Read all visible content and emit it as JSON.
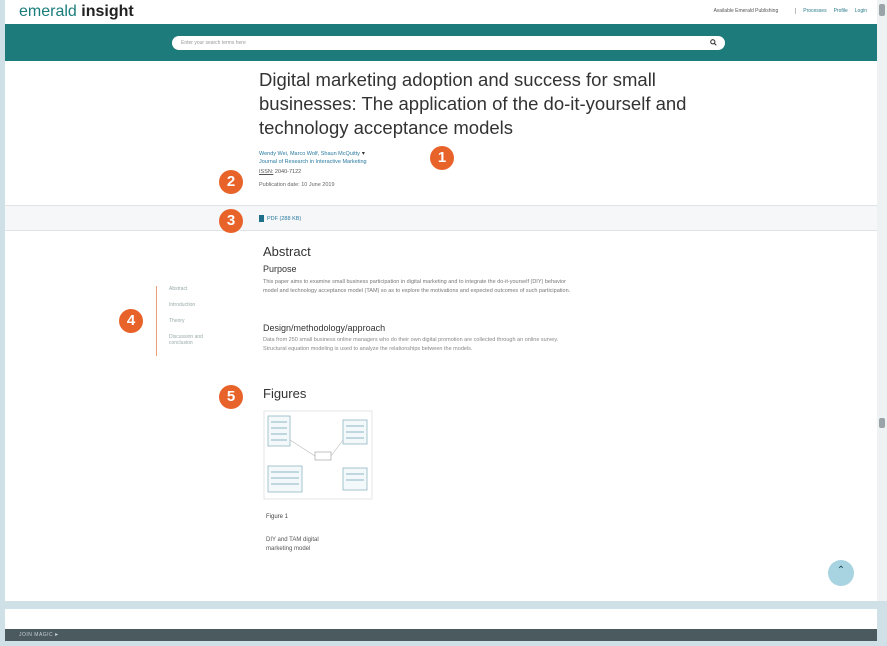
{
  "header": {
    "logo_part1": "emerald",
    "logo_part2": "insight",
    "institution": "Available Emerald Publishing",
    "links": [
      "Processes",
      "Profile",
      "Login"
    ]
  },
  "search": {
    "placeholder": "Enter your search terms here"
  },
  "article": {
    "title": "Digital marketing adoption and success for small businesses: The application of the do-it-yourself and technology acceptance models",
    "authors": "Wendy Wei, Marco Wolf, Shaun McQuitty",
    "journal": "Journal of Research in Interactive Marketing",
    "issn_label": "ISSN:",
    "issn_value": "2040-7122",
    "pubdate": "Publication date: 10 June 2019",
    "pdf": "PDF (288 KB)"
  },
  "side_nav": [
    "Abstract",
    "Introduction",
    "Theory",
    "Discussion and conclusion"
  ],
  "abstract": {
    "heading": "Abstract",
    "purpose_heading": "Purpose",
    "purpose_text": "This paper aims to examine small business participation in digital marketing and to integrate the do-it-yourself (DIY) behavior model and technology acceptance model (TAM) so as to explore the motivations and expected outcomes of such participation.",
    "design_heading": "Design/methodology/approach",
    "design_text": "Data from 250 small business online managers who do their own digital promotion are collected through an online survey. Structural equation modeling is used to analyze the relationships between the models."
  },
  "figures": {
    "heading": "Figures",
    "caption": "Figure 1",
    "description": "DIY and TAM digital marketing model"
  },
  "footer": {
    "label": "JOIN MAGIC"
  },
  "callouts": [
    "1",
    "2",
    "3",
    "4",
    "5"
  ]
}
